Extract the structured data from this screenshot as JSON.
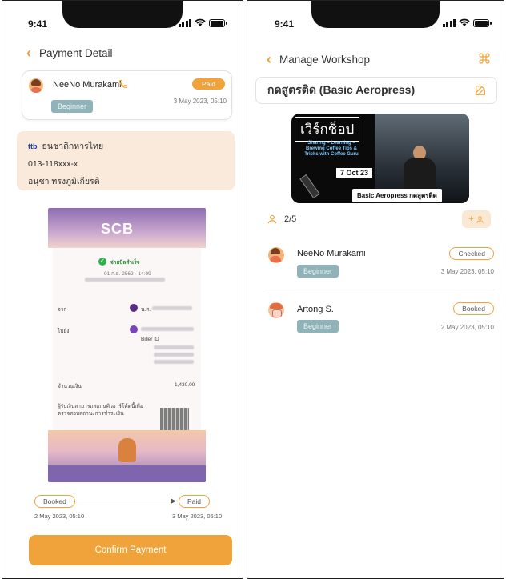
{
  "left": {
    "status_time": "9:41",
    "nav_title": "Payment Detail",
    "booking": {
      "name": "NeeNo Murakami",
      "status": "Paid",
      "level": "Beginner",
      "date": "3 May 2023, 05:10"
    },
    "bank": {
      "bank_logo": "ttb",
      "bank_name": "ธนชาติกหารไทย",
      "account_number": "013-118xxx-x",
      "account_name": "อนุชา ทรงภูมิเกียรติ"
    },
    "slip": {
      "brand": "SCB",
      "status_text": "จ่ายบิลสำเร็จ",
      "date_time": "01 ก.ย. 2562 - 14:09",
      "from_label": "จาก",
      "from_name": "น.ส.",
      "to_label": "ไปยัง",
      "biller_id_label": "Biller ID",
      "amount_label": "จำนวนเงิน",
      "amount": "1,430.00",
      "verify_note": "ผู้รับเงินสามารถสแกนคิวอาร์โค้ดนี้เพื่อ ตรวจสอบสถานะการชำระเงิน"
    },
    "timeline": {
      "from_label": "Booked",
      "to_label": "Paid",
      "from_date": "2 May 2023, 05:10",
      "to_date": "3 May 2023, 05:10"
    },
    "confirm_button": "Confirm Payment"
  },
  "right": {
    "status_time": "9:41",
    "nav_title": "Manage Workshop",
    "workshop_title": "กดสูตรติด (Basic Aeropress)",
    "banner": {
      "title": "เวิร์กช็อป",
      "subtitle": "Sharing – Learning – Brewing Coffee Tips & Tricks with Coffee Guru",
      "date": "7 Oct 23",
      "caption": "Basic Aeropress กดสูตรติด"
    },
    "participants_count": "2/5",
    "participants": [
      {
        "name": "NeeNo Murakami",
        "level": "Beginner",
        "status": "Checked",
        "date": "3 May 2023, 05:10"
      },
      {
        "name": "Artong S.",
        "level": "Beginner",
        "status": "Booked",
        "date": "2 May 2023, 05:10"
      }
    ]
  },
  "colors": {
    "accent": "#f0a33a",
    "tag_bg": "#8fb3b8",
    "bank_box_bg": "#faeadb"
  }
}
